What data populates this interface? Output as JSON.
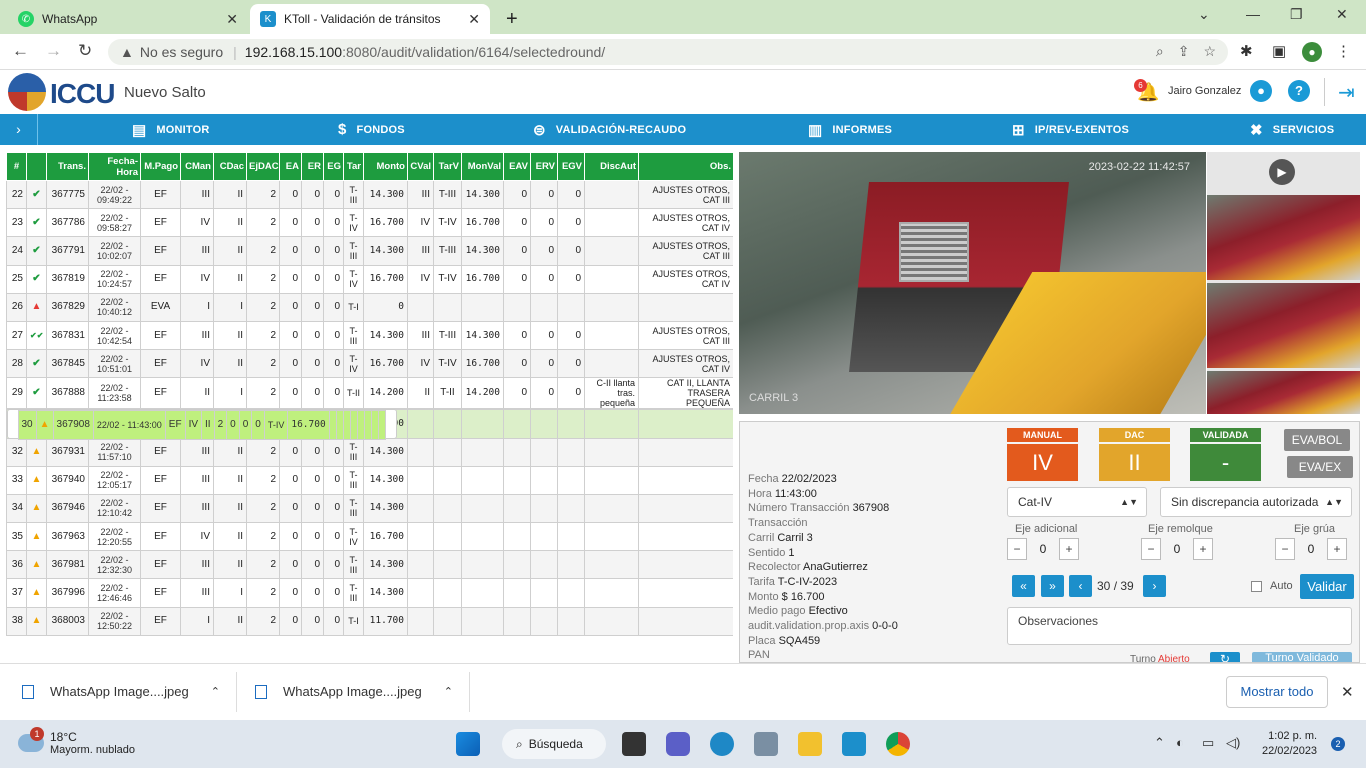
{
  "browser": {
    "tabs": [
      {
        "title": "WhatsApp",
        "active": false
      },
      {
        "title": "KToll - Validación de tránsitos",
        "active": true
      }
    ],
    "new_tab": "+",
    "insecure_label": "No es seguro",
    "url_host": "192.168.15.100",
    "url_path": ":8080/audit/validation/6164/selectedround/"
  },
  "app": {
    "logo_text": "ICCU",
    "site": "Nuevo Salto",
    "notification_count": "6",
    "user": "Jairo Gonzalez",
    "help": "?"
  },
  "nav": {
    "toggle": "›",
    "items": [
      "MONITOR",
      "FONDOS",
      "VALIDACIÓN-RECAUDO",
      "INFORMES",
      "IP/REV-EXENTOS",
      "SERVICIOS"
    ]
  },
  "table": {
    "headers": [
      "#",
      "",
      "Trans.",
      "Fecha-Hora",
      "M.Pago",
      "CMan",
      "CDac",
      "EjDAC",
      "EA",
      "ER",
      "EG",
      "Tar",
      "Monto",
      "CVal",
      "TarV",
      "MonVal",
      "EAV",
      "ERV",
      "EGV",
      "DiscAut",
      "Obs."
    ],
    "rows": [
      {
        "n": "22",
        "st": "ok",
        "trans": "367775",
        "fecha": "22/02 - 09:49:22",
        "mp": "EF",
        "cman": "III",
        "cdac": "II",
        "ejdac": "2",
        "ea": "0",
        "er": "0",
        "eg": "0",
        "tar": "T-III",
        "monto": "14.300",
        "cval": "III",
        "tarv": "T-III",
        "monval": "14.300",
        "eav": "0",
        "erv": "0",
        "egv": "0",
        "disc": "",
        "obs": "AJUSTES OTROS, CAT III",
        "cls": ""
      },
      {
        "n": "23",
        "st": "ok",
        "trans": "367786",
        "fecha": "22/02 - 09:58:27",
        "mp": "EF",
        "cman": "IV",
        "cdac": "II",
        "ejdac": "2",
        "ea": "0",
        "er": "0",
        "eg": "0",
        "tar": "T-IV",
        "monto": "16.700",
        "cval": "IV",
        "tarv": "T-IV",
        "monval": "16.700",
        "eav": "0",
        "erv": "0",
        "egv": "0",
        "disc": "",
        "obs": "AJUSTES OTROS, CAT IV",
        "cls": ""
      },
      {
        "n": "24",
        "st": "ok",
        "trans": "367791",
        "fecha": "22/02 - 10:02:07",
        "mp": "EF",
        "cman": "III",
        "cdac": "II",
        "ejdac": "2",
        "ea": "0",
        "er": "0",
        "eg": "0",
        "tar": "T-III",
        "monto": "14.300",
        "cval": "III",
        "tarv": "T-III",
        "monval": "14.300",
        "eav": "0",
        "erv": "0",
        "egv": "0",
        "disc": "",
        "obs": "AJUSTES OTROS, CAT III",
        "cls": ""
      },
      {
        "n": "25",
        "st": "ok",
        "trans": "367819",
        "fecha": "22/02 - 10:24:57",
        "mp": "EF",
        "cman": "IV",
        "cdac": "II",
        "ejdac": "2",
        "ea": "0",
        "er": "0",
        "eg": "0",
        "tar": "T-IV",
        "monto": "16.700",
        "cval": "IV",
        "tarv": "T-IV",
        "monval": "16.700",
        "eav": "0",
        "erv": "0",
        "egv": "0",
        "disc": "",
        "obs": "AJUSTES OTROS, CAT IV",
        "cls": ""
      },
      {
        "n": "26",
        "st": "err",
        "trans": "367829",
        "fecha": "22/02 - 10:40:12",
        "mp": "EVA",
        "cman": "I",
        "cdac": "I",
        "ejdac": "2",
        "ea": "0",
        "er": "0",
        "eg": "0",
        "tar": "T-I",
        "monto": "0",
        "cval": "",
        "tarv": "",
        "monval": "",
        "eav": "",
        "erv": "",
        "egv": "",
        "disc": "",
        "obs": "",
        "cls": ""
      },
      {
        "n": "27",
        "st": "ok2",
        "trans": "367831",
        "fecha": "22/02 - 10:42:54",
        "mp": "EF",
        "cman": "III",
        "cdac": "II",
        "ejdac": "2",
        "ea": "0",
        "er": "0",
        "eg": "0",
        "tar": "T-III",
        "monto": "14.300",
        "cval": "III",
        "tarv": "T-III",
        "monval": "14.300",
        "eav": "0",
        "erv": "0",
        "egv": "0",
        "disc": "",
        "obs": "AJUSTES OTROS, CAT III",
        "cls": ""
      },
      {
        "n": "28",
        "st": "ok",
        "trans": "367845",
        "fecha": "22/02 - 10:51:01",
        "mp": "EF",
        "cman": "IV",
        "cdac": "II",
        "ejdac": "2",
        "ea": "0",
        "er": "0",
        "eg": "0",
        "tar": "T-IV",
        "monto": "16.700",
        "cval": "IV",
        "tarv": "T-IV",
        "monval": "16.700",
        "eav": "0",
        "erv": "0",
        "egv": "0",
        "disc": "",
        "obs": "AJUSTES OTROS, CAT IV",
        "cls": ""
      },
      {
        "n": "29",
        "st": "ok",
        "trans": "367888",
        "fecha": "22/02 - 11:23:58",
        "mp": "EF",
        "cman": "II",
        "cdac": "I",
        "ejdac": "2",
        "ea": "0",
        "er": "0",
        "eg": "0",
        "tar": "T-II",
        "monto": "14.200",
        "cval": "II",
        "tarv": "T-II",
        "monval": "14.200",
        "eav": "0",
        "erv": "0",
        "egv": "0",
        "disc": "C-II llanta tras. pequeña",
        "obs": "CAT II, LLANTA TRASERA PEQUEÑA",
        "cls": ""
      },
      {
        "n": "30",
        "st": "warn",
        "trans": "367908",
        "fecha": "22/02 - 11:43:00",
        "mp": "EF",
        "cman": "IV",
        "cdac": "II",
        "ejdac": "2",
        "ea": "0",
        "er": "0",
        "eg": "0",
        "tar": "T-IV",
        "monto": "16.700",
        "cval": "",
        "tarv": "",
        "monval": "",
        "eav": "",
        "erv": "",
        "egv": "",
        "disc": "",
        "obs": "",
        "cls": "sel"
      },
      {
        "n": "31",
        "st": "warn",
        "trans": "367915",
        "fecha": "22/02 - 11:46:07",
        "mp": "EF",
        "cman": "IV",
        "cdac": "II",
        "ejdac": "2",
        "ea": "0",
        "er": "0",
        "eg": "0",
        "tar": "T-IV",
        "monto": "16.700",
        "cval": "",
        "tarv": "",
        "monval": "",
        "eav": "",
        "erv": "",
        "egv": "",
        "disc": "",
        "obs": "",
        "cls": "sel2"
      },
      {
        "n": "32",
        "st": "warn",
        "trans": "367931",
        "fecha": "22/02 - 11:57:10",
        "mp": "EF",
        "cman": "III",
        "cdac": "II",
        "ejdac": "2",
        "ea": "0",
        "er": "0",
        "eg": "0",
        "tar": "T-III",
        "monto": "14.300",
        "cval": "",
        "tarv": "",
        "monval": "",
        "eav": "",
        "erv": "",
        "egv": "",
        "disc": "",
        "obs": "",
        "cls": ""
      },
      {
        "n": "33",
        "st": "warn",
        "trans": "367940",
        "fecha": "22/02 - 12:05:17",
        "mp": "EF",
        "cman": "III",
        "cdac": "II",
        "ejdac": "2",
        "ea": "0",
        "er": "0",
        "eg": "0",
        "tar": "T-III",
        "monto": "14.300",
        "cval": "",
        "tarv": "",
        "monval": "",
        "eav": "",
        "erv": "",
        "egv": "",
        "disc": "",
        "obs": "",
        "cls": ""
      },
      {
        "n": "34",
        "st": "warn",
        "trans": "367946",
        "fecha": "22/02 - 12:10:42",
        "mp": "EF",
        "cman": "III",
        "cdac": "II",
        "ejdac": "2",
        "ea": "0",
        "er": "0",
        "eg": "0",
        "tar": "T-III",
        "monto": "14.300",
        "cval": "",
        "tarv": "",
        "monval": "",
        "eav": "",
        "erv": "",
        "egv": "",
        "disc": "",
        "obs": "",
        "cls": ""
      },
      {
        "n": "35",
        "st": "warn",
        "trans": "367963",
        "fecha": "22/02 - 12:20:55",
        "mp": "EF",
        "cman": "IV",
        "cdac": "II",
        "ejdac": "2",
        "ea": "0",
        "er": "0",
        "eg": "0",
        "tar": "T-IV",
        "monto": "16.700",
        "cval": "",
        "tarv": "",
        "monval": "",
        "eav": "",
        "erv": "",
        "egv": "",
        "disc": "",
        "obs": "",
        "cls": ""
      },
      {
        "n": "36",
        "st": "warn",
        "trans": "367981",
        "fecha": "22/02 - 12:32:30",
        "mp": "EF",
        "cman": "III",
        "cdac": "II",
        "ejdac": "2",
        "ea": "0",
        "er": "0",
        "eg": "0",
        "tar": "T-III",
        "monto": "14.300",
        "cval": "",
        "tarv": "",
        "monval": "",
        "eav": "",
        "erv": "",
        "egv": "",
        "disc": "",
        "obs": "",
        "cls": ""
      },
      {
        "n": "37",
        "st": "warn",
        "trans": "367996",
        "fecha": "22/02 - 12:46:46",
        "mp": "EF",
        "cman": "III",
        "cdac": "I",
        "ejdac": "2",
        "ea": "0",
        "er": "0",
        "eg": "0",
        "tar": "T-III",
        "monto": "14.300",
        "cval": "",
        "tarv": "",
        "monval": "",
        "eav": "",
        "erv": "",
        "egv": "",
        "disc": "",
        "obs": "",
        "cls": ""
      },
      {
        "n": "38",
        "st": "warn",
        "trans": "368003",
        "fecha": "22/02 - 12:50:22",
        "mp": "EF",
        "cman": "I",
        "cdac": "II",
        "ejdac": "2",
        "ea": "0",
        "er": "0",
        "eg": "0",
        "tar": "T-I",
        "monto": "11.700",
        "cval": "",
        "tarv": "",
        "monval": "",
        "eav": "",
        "erv": "",
        "egv": "",
        "disc": "",
        "obs": "",
        "cls": ""
      }
    ]
  },
  "camera": {
    "timestamp": "2023-02-22 11:42:57",
    "lane": "CARRIL 3",
    "plate": "SQA459"
  },
  "detail": {
    "fields": [
      {
        "label": "Fecha",
        "value": "22/02/2023"
      },
      {
        "label": "Hora",
        "value": "11:43:00"
      },
      {
        "label": "Número Transacción",
        "value": "367908"
      },
      {
        "label": "Transacción",
        "value": ""
      },
      {
        "label": "Carril",
        "value": "Carril 3"
      },
      {
        "label": "Sentido",
        "value": "1"
      },
      {
        "label": "Recolector",
        "value": "AnaGutierrez"
      },
      {
        "label": "Tarifa",
        "value": "T-C-IV-2023"
      },
      {
        "label": "Monto",
        "value": "$ 16.700"
      },
      {
        "label": "Medio pago",
        "value": "Efectivo"
      },
      {
        "label": "audit.validation.prop.axis",
        "value": "0-0-0"
      },
      {
        "label": "Placa",
        "value": "SQA459"
      },
      {
        "label": "PAN",
        "value": ""
      }
    ],
    "manual": {
      "label": "MANUAL",
      "value": "IV",
      "color": "#e35a1d"
    },
    "dac": {
      "label": "DAC",
      "value": "II",
      "color": "#e2a52b"
    },
    "validada": {
      "label": "VALIDADA",
      "value": "-",
      "color": "#3f8a3a"
    },
    "eva_bol": "EVA/BOL",
    "eva_ex": "EVA/EX",
    "cat_select": "Cat-IV",
    "disc_select": "Sin discrepancia autorizada",
    "eje_adicional": {
      "label": "Eje adicional",
      "value": "0"
    },
    "eje_remolque": {
      "label": "Eje remolque",
      "value": "0"
    },
    "eje_grua": {
      "label": "Eje grúa",
      "value": "0"
    },
    "page_current": "30",
    "page_total": "/ 39",
    "auto_label": "Auto",
    "validar_label": "Validar",
    "obs_placeholder": "Observaciones",
    "turno_label": "Turno",
    "turno_status": "Abierto",
    "turno_validado": "Turno Validado"
  },
  "downloads": {
    "items": [
      "WhatsApp Image....jpeg",
      "WhatsApp Image....jpeg"
    ],
    "show_all": "Mostrar todo"
  },
  "taskbar": {
    "weather_temp": "18°C",
    "weather_desc": "Mayorm. nublado",
    "weather_badge": "1",
    "search": "Búsqueda",
    "time": "1:02 p. m.",
    "date": "22/02/2023",
    "notif": "2"
  }
}
